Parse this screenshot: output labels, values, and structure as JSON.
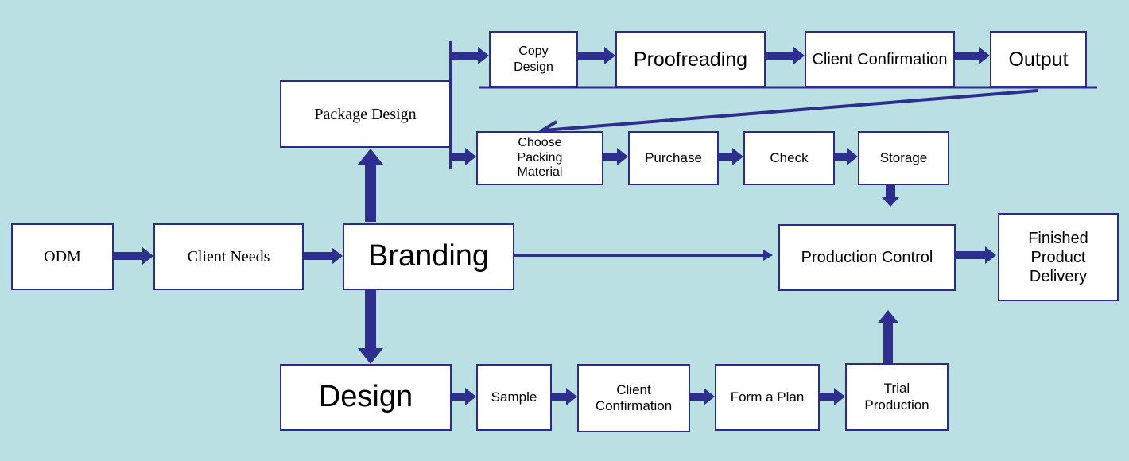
{
  "nodes": {
    "odm": "ODM",
    "client_needs": "Client Needs",
    "branding": "Branding",
    "package_design": "Package Design",
    "design": "Design",
    "copy_design": "Copy Design",
    "proofreading": "Proofreading",
    "client_confirmation_top": "Client Confirmation",
    "output": "Output",
    "choose_packing_material": "Choose Packing Material",
    "purchase": "Purchase",
    "check": "Check",
    "storage": "Storage",
    "production_control": "Production Control",
    "finished_product_delivery": "Finished Product Delivery",
    "sample": "Sample",
    "client_confirmation_bottom": "Client Confirmation",
    "form_a_plan": "Form a Plan",
    "trial_production": "Trial Production"
  },
  "colors": {
    "background": "#bae0e3",
    "arrow": "#2e2e8f",
    "box_border": "#2b2b8c"
  }
}
